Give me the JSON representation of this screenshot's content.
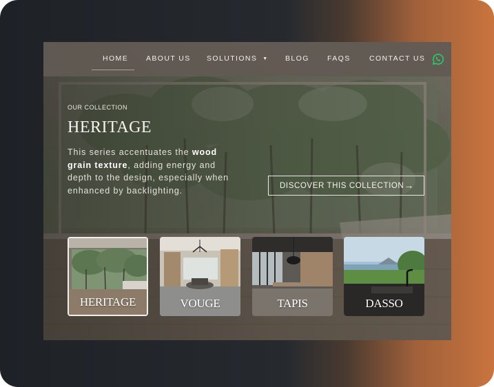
{
  "colors": {
    "accent_whatsapp": "#25d366",
    "nav_background": "#625a54",
    "text_light": "#f2efea"
  },
  "nav": {
    "items": [
      {
        "label": "HOME",
        "active": true
      },
      {
        "label": "ABOUT US"
      },
      {
        "label": "SOLUTIONS",
        "has_dropdown": true
      },
      {
        "label": "BLOG"
      },
      {
        "label": "FAQS"
      },
      {
        "label": "CONTACT US"
      }
    ],
    "social_icon": "whatsapp-icon"
  },
  "hero": {
    "eyebrow": "OUR COLLECTION",
    "title": "HERITAGE",
    "description": {
      "part1": "This series accentuates the ",
      "bold": "wood grain texture",
      "part2": ", adding energy and depth to the design, especially when enhanced by backlighting."
    },
    "cta": {
      "label": "DISCOVER  THIS  COLLECTION",
      "arrow": "→"
    }
  },
  "collections": [
    {
      "label": "HERITAGE",
      "active": true
    },
    {
      "label": "VOUGE"
    },
    {
      "label": "TAPIS"
    },
    {
      "label": "DASSO"
    }
  ]
}
